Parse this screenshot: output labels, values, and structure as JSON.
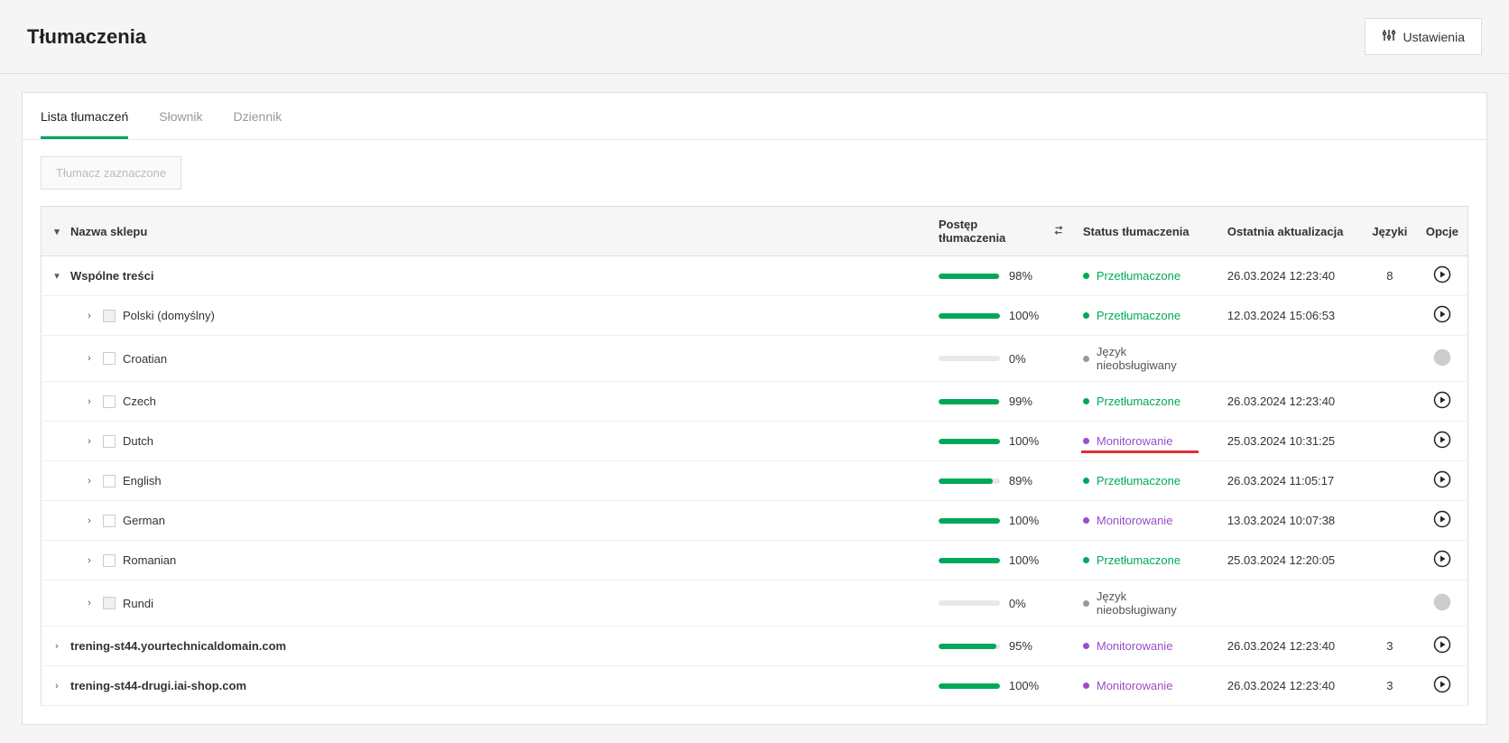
{
  "page": {
    "title": "Tłumaczenia",
    "settings_label": "Ustawienia"
  },
  "tabs": {
    "list": "Lista tłumaczeń",
    "dict": "Słownik",
    "diary": "Dziennik"
  },
  "toolbar": {
    "translate_selected": "Tłumacz zaznaczone"
  },
  "columns": {
    "name": "Nazwa sklepu",
    "progress": "Postęp tłumaczenia",
    "status": "Status tłumaczenia",
    "updated": "Ostatnia aktualizacja",
    "langs": "Języki",
    "opts": "Opcje"
  },
  "status_labels": {
    "translated": "Przetłumaczone",
    "monitoring": "Monitorowanie",
    "unsupported": "Język nieobsługiwany"
  },
  "rows": [
    {
      "id": "r0",
      "indent": 0,
      "expander": "down",
      "checkbox": false,
      "bold": true,
      "name": "Wspólne treści",
      "progress": 98,
      "status": "translated",
      "updated": "26.03.2024 12:23:40",
      "langs": "8",
      "opts": true,
      "underline": false
    },
    {
      "id": "r1",
      "indent": 2,
      "expander": "right",
      "checkbox": true,
      "cbdisabled": true,
      "bold": false,
      "name": "Polski (domyślny)",
      "progress": 100,
      "status": "translated",
      "updated": "12.03.2024 15:06:53",
      "langs": "",
      "opts": true,
      "underline": false
    },
    {
      "id": "r2",
      "indent": 2,
      "expander": "right",
      "checkbox": true,
      "cbdisabled": false,
      "bold": false,
      "name": "Croatian",
      "progress": 0,
      "status": "unsupported",
      "updated": "",
      "langs": "",
      "opts": false,
      "underline": false
    },
    {
      "id": "r3",
      "indent": 2,
      "expander": "right",
      "checkbox": true,
      "cbdisabled": false,
      "bold": false,
      "name": "Czech",
      "progress": 99,
      "status": "translated",
      "updated": "26.03.2024 12:23:40",
      "langs": "",
      "opts": true,
      "underline": false
    },
    {
      "id": "r4",
      "indent": 2,
      "expander": "right",
      "checkbox": true,
      "cbdisabled": false,
      "bold": false,
      "name": "Dutch",
      "progress": 100,
      "status": "monitoring",
      "updated": "25.03.2024 10:31:25",
      "langs": "",
      "opts": true,
      "underline": true
    },
    {
      "id": "r5",
      "indent": 2,
      "expander": "right",
      "checkbox": true,
      "cbdisabled": false,
      "bold": false,
      "name": "English",
      "progress": 89,
      "status": "translated",
      "updated": "26.03.2024 11:05:17",
      "langs": "",
      "opts": true,
      "underline": false
    },
    {
      "id": "r6",
      "indent": 2,
      "expander": "right",
      "checkbox": true,
      "cbdisabled": false,
      "bold": false,
      "name": "German",
      "progress": 100,
      "status": "monitoring",
      "updated": "13.03.2024 10:07:38",
      "langs": "",
      "opts": true,
      "underline": false
    },
    {
      "id": "r7",
      "indent": 2,
      "expander": "right",
      "checkbox": true,
      "cbdisabled": false,
      "bold": false,
      "name": "Romanian",
      "progress": 100,
      "status": "translated",
      "updated": "25.03.2024 12:20:05",
      "langs": "",
      "opts": true,
      "underline": false
    },
    {
      "id": "r8",
      "indent": 2,
      "expander": "right",
      "checkbox": true,
      "cbdisabled": true,
      "bold": false,
      "name": "Rundi",
      "progress": 0,
      "status": "unsupported",
      "updated": "",
      "langs": "",
      "opts": false,
      "underline": false
    },
    {
      "id": "r9",
      "indent": 0,
      "expander": "right",
      "checkbox": false,
      "bold": true,
      "name": "trening-st44.yourtechnicaldomain.com",
      "progress": 95,
      "status": "monitoring",
      "updated": "26.03.2024 12:23:40",
      "langs": "3",
      "opts": true,
      "underline": false
    },
    {
      "id": "r10",
      "indent": 0,
      "expander": "right",
      "checkbox": false,
      "bold": true,
      "name": "trening-st44-drugi.iai-shop.com",
      "progress": 100,
      "status": "monitoring",
      "updated": "26.03.2024 12:23:40",
      "langs": "3",
      "opts": true,
      "underline": false
    }
  ]
}
